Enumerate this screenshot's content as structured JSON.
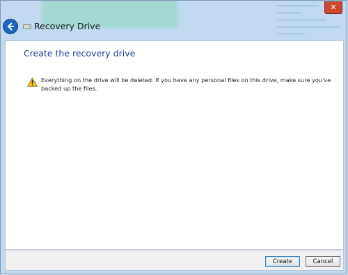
{
  "window": {
    "title": "Recovery Drive",
    "close_glyph": "✕",
    "icons": {
      "back": "back-arrow-icon",
      "drive": "drive-icon",
      "close": "close-icon",
      "warning": "warning-icon"
    },
    "colors": {
      "accent": "#1c66c2",
      "heading": "#1a3d9a",
      "close": "#c9482f"
    }
  },
  "content": {
    "heading": "Create the recovery drive",
    "warning_text": "Everything on the drive will be deleted. If you have any personal files on this drive, make sure you've backed up the files."
  },
  "footer": {
    "create_label": "Create",
    "cancel_label": "Cancel"
  }
}
